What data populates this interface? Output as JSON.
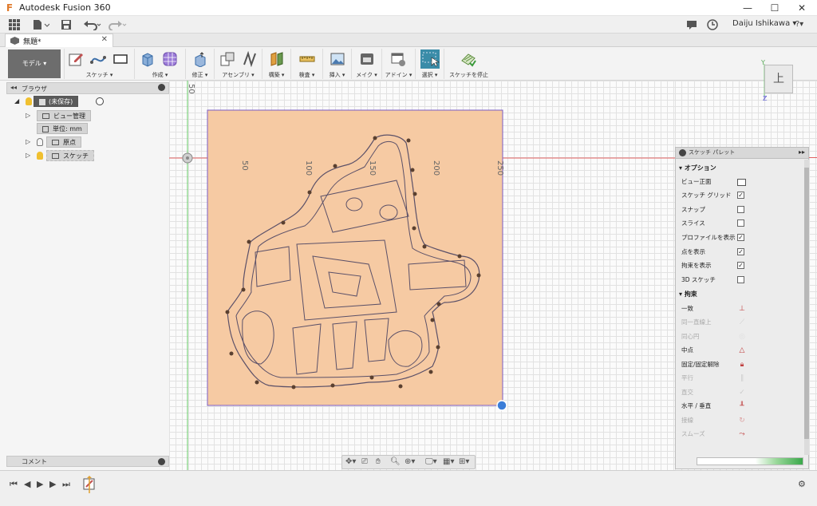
{
  "window": {
    "title": "Autodesk Fusion 360",
    "min": "—",
    "max": "☐",
    "close": "✕"
  },
  "appbar": {
    "user": "Daiju Ishikawa ▾",
    "help": "?▾"
  },
  "document_tab": {
    "title": "無題*",
    "close": "✕"
  },
  "toolbar": {
    "mode": "モデル ▾",
    "groups": [
      {
        "label": "スケッチ ▾"
      },
      {
        "label": "作成 ▾"
      },
      {
        "label": "修正 ▾"
      },
      {
        "label": "アセンブリ ▾"
      },
      {
        "label": "構築 ▾"
      },
      {
        "label": "検査 ▾"
      },
      {
        "label": "挿入 ▾"
      },
      {
        "label": "メイク ▾"
      },
      {
        "label": "アドイン ▾"
      },
      {
        "label": "選択 ▾"
      },
      {
        "label": "スケッチを停止"
      }
    ]
  },
  "browser": {
    "title": "ブラウザ",
    "root": "(未保存)",
    "items": [
      {
        "label": "ビュー管理"
      },
      {
        "label": "単位: mm"
      },
      {
        "label": "原点"
      },
      {
        "label": "スケッチ"
      }
    ]
  },
  "comments": {
    "title": "コメント"
  },
  "canvas": {
    "ruler_ticks": [
      "50",
      "100",
      "150",
      "200",
      "250"
    ],
    "vertical_tick": "50"
  },
  "viewcube": {
    "face": "上",
    "axis_z": "Z",
    "axis_y": "Y"
  },
  "palette": {
    "title": "スケッチ パレット",
    "options_header": "オプション",
    "options": [
      {
        "label": "ビュー正面",
        "kind": "icon"
      },
      {
        "label": "スケッチ グリッド",
        "checked": true
      },
      {
        "label": "スナップ",
        "checked": false
      },
      {
        "label": "スライス",
        "checked": false
      },
      {
        "label": "プロファイルを表示",
        "checked": true
      },
      {
        "label": "点を表示",
        "checked": true
      },
      {
        "label": "拘束を表示",
        "checked": true
      },
      {
        "label": "3D スケッチ",
        "checked": false
      }
    ],
    "constraints_header": "拘束",
    "constraints": [
      {
        "label": "一致",
        "enabled": true
      },
      {
        "label": "同一直線上",
        "enabled": false
      },
      {
        "label": "同心円",
        "enabled": false
      },
      {
        "label": "中点",
        "enabled": true
      },
      {
        "label": "固定/固定解除",
        "enabled": true
      },
      {
        "label": "平行",
        "enabled": false
      },
      {
        "label": "直交",
        "enabled": false
      },
      {
        "label": "水平 / 垂直",
        "enabled": true
      },
      {
        "label": "接線",
        "enabled": false
      },
      {
        "label": "スムーズ",
        "enabled": false
      }
    ]
  },
  "colors": {
    "accent": "#e07a2b",
    "sketch_fill": "#f6caa3",
    "selection_blue": "#3b7dd8",
    "x_axis": "#e06060",
    "y_axis": "#66cc66",
    "profile_stroke": "#7b5cc4"
  }
}
